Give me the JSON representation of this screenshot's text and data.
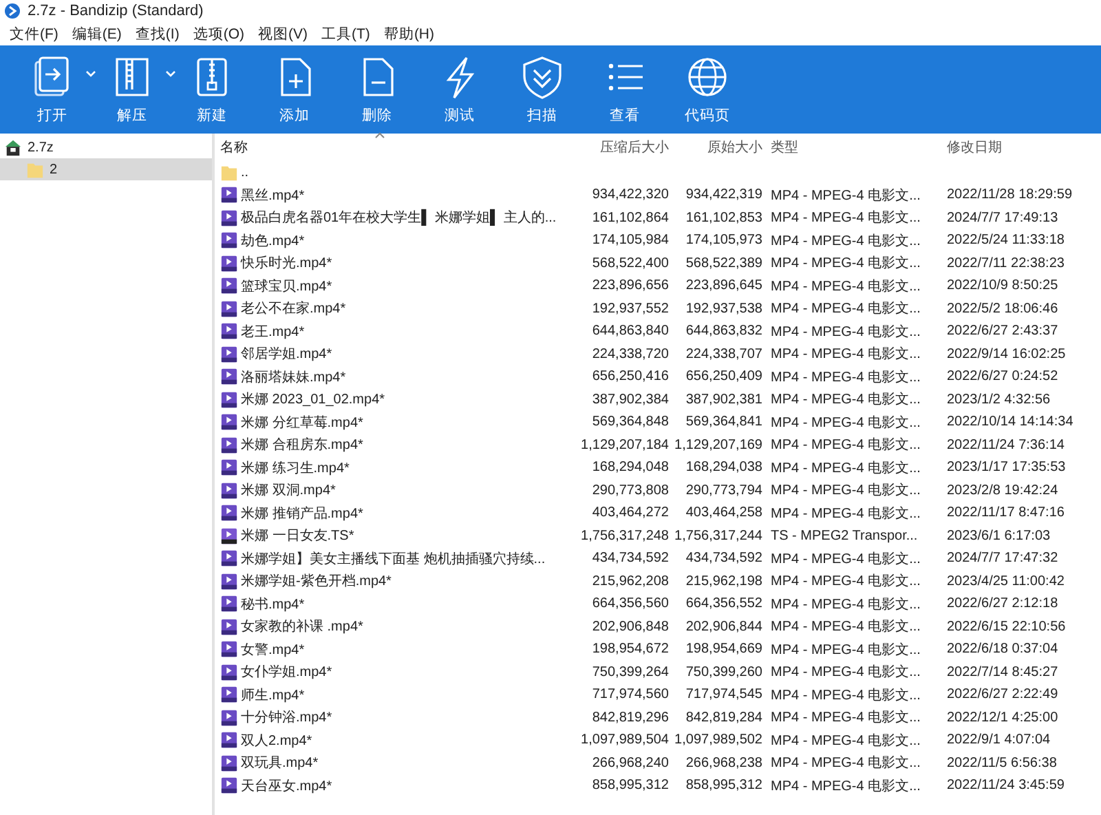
{
  "window": {
    "title": "2.7z - Bandizip (Standard)"
  },
  "menu": [
    "文件(F)",
    "编辑(E)",
    "查找(I)",
    "选项(O)",
    "视图(V)",
    "工具(T)",
    "帮助(H)"
  ],
  "toolbar": [
    {
      "label": "打开",
      "kind": "open",
      "has_menu": true
    },
    {
      "label": "解压",
      "kind": "extract",
      "has_menu": true
    },
    {
      "label": "新建",
      "kind": "new",
      "has_menu": false
    },
    {
      "label": "添加",
      "kind": "add",
      "has_menu": false
    },
    {
      "label": "删除",
      "kind": "delete",
      "has_menu": false
    },
    {
      "label": "测试",
      "kind": "test",
      "has_menu": false
    },
    {
      "label": "扫描",
      "kind": "scan",
      "has_menu": false
    },
    {
      "label": "查看",
      "kind": "view",
      "has_menu": false
    },
    {
      "label": "代码页",
      "kind": "codepage",
      "has_menu": false
    }
  ],
  "tree": [
    {
      "label": "2.7z",
      "kind": "archive",
      "selected": false,
      "children": [
        {
          "label": "2",
          "kind": "folder",
          "selected": true
        }
      ]
    }
  ],
  "table": {
    "columns": [
      {
        "label": "名称",
        "sorted": true
      },
      {
        "label": "压缩后大小",
        "sorted": false
      },
      {
        "label": "原始大小",
        "sorted": false
      },
      {
        "label": "类型",
        "sorted": false
      },
      {
        "label": "修改日期",
        "sorted": false
      }
    ],
    "rows": [
      {
        "kind": "folder",
        "name": ".."
      },
      {
        "kind": "mp4",
        "name": "黑丝.mp4*",
        "packed": "934,422,320",
        "size": "934,422,319",
        "type": "MP4 - MPEG-4 电影文...",
        "date": "2022/11/28 18:29:59"
      },
      {
        "kind": "mp4",
        "name": "极品白虎名器01年在校大学生▌ 米娜学姐▌ 主人的...",
        "packed": "161,102,864",
        "size": "161,102,853",
        "type": "MP4 - MPEG-4 电影文...",
        "date": "2024/7/7 17:49:13"
      },
      {
        "kind": "mp4",
        "name": "劫色.mp4*",
        "packed": "174,105,984",
        "size": "174,105,973",
        "type": "MP4 - MPEG-4 电影文...",
        "date": "2022/5/24 11:33:18"
      },
      {
        "kind": "mp4",
        "name": "快乐时光.mp4*",
        "packed": "568,522,400",
        "size": "568,522,389",
        "type": "MP4 - MPEG-4 电影文...",
        "date": "2022/7/11 22:38:23"
      },
      {
        "kind": "mp4",
        "name": "篮球宝贝.mp4*",
        "packed": "223,896,656",
        "size": "223,896,645",
        "type": "MP4 - MPEG-4 电影文...",
        "date": "2022/10/9 8:50:25"
      },
      {
        "kind": "mp4",
        "name": "老公不在家.mp4*",
        "packed": "192,937,552",
        "size": "192,937,538",
        "type": "MP4 - MPEG-4 电影文...",
        "date": "2022/5/2 18:06:46"
      },
      {
        "kind": "mp4",
        "name": "老王.mp4*",
        "packed": "644,863,840",
        "size": "644,863,832",
        "type": "MP4 - MPEG-4 电影文...",
        "date": "2022/6/27 2:43:37"
      },
      {
        "kind": "mp4",
        "name": "邻居学姐.mp4*",
        "packed": "224,338,720",
        "size": "224,338,707",
        "type": "MP4 - MPEG-4 电影文...",
        "date": "2022/9/14 16:02:25"
      },
      {
        "kind": "mp4",
        "name": "洛丽塔妹妹.mp4*",
        "packed": "656,250,416",
        "size": "656,250,409",
        "type": "MP4 - MPEG-4 电影文...",
        "date": "2022/6/27 0:24:52"
      },
      {
        "kind": "mp4",
        "name": "米娜 2023_01_02.mp4*",
        "packed": "387,902,384",
        "size": "387,902,381",
        "type": "MP4 - MPEG-4 电影文...",
        "date": "2023/1/2 4:32:56"
      },
      {
        "kind": "mp4",
        "name": "米娜 分红草莓.mp4*",
        "packed": "569,364,848",
        "size": "569,364,841",
        "type": "MP4 - MPEG-4 电影文...",
        "date": "2022/10/14 14:14:34"
      },
      {
        "kind": "mp4",
        "name": "米娜 合租房东.mp4*",
        "packed": "1,129,207,184",
        "size": "1,129,207,169",
        "type": "MP4 - MPEG-4 电影文...",
        "date": "2022/11/24 7:36:14"
      },
      {
        "kind": "mp4",
        "name": "米娜 练习生.mp4*",
        "packed": "168,294,048",
        "size": "168,294,038",
        "type": "MP4 - MPEG-4 电影文...",
        "date": "2023/1/17 17:35:53"
      },
      {
        "kind": "mp4",
        "name": "米娜 双洞.mp4*",
        "packed": "290,773,808",
        "size": "290,773,794",
        "type": "MP4 - MPEG-4 电影文...",
        "date": "2023/2/8 19:42:24"
      },
      {
        "kind": "mp4",
        "name": "米娜 推销产品.mp4*",
        "packed": "403,464,272",
        "size": "403,464,258",
        "type": "MP4 - MPEG-4 电影文...",
        "date": "2022/11/17 8:47:16"
      },
      {
        "kind": "ts",
        "name": "米娜 一日女友.TS*",
        "packed": "1,756,317,248",
        "size": "1,756,317,244",
        "type": "TS - MPEG2 Transpor...",
        "date": "2023/6/1 6:17:03"
      },
      {
        "kind": "mp4",
        "name": "米娜学姐】美女主播线下面基 炮机抽插骚穴持续...",
        "packed": "434,734,592",
        "size": "434,734,592",
        "type": "MP4 - MPEG-4 电影文...",
        "date": "2024/7/7 17:47:32"
      },
      {
        "kind": "mp4",
        "name": "米娜学姐-紫色开档.mp4*",
        "packed": "215,962,208",
        "size": "215,962,198",
        "type": "MP4 - MPEG-4 电影文...",
        "date": "2023/4/25 11:00:42"
      },
      {
        "kind": "mp4",
        "name": "秘书.mp4*",
        "packed": "664,356,560",
        "size": "664,356,552",
        "type": "MP4 - MPEG-4 电影文...",
        "date": "2022/6/27 2:12:18"
      },
      {
        "kind": "mp4",
        "name": "女家教的补课 .mp4*",
        "packed": "202,906,848",
        "size": "202,906,844",
        "type": "MP4 - MPEG-4 电影文...",
        "date": "2022/6/15 22:10:56"
      },
      {
        "kind": "mp4",
        "name": "女警.mp4*",
        "packed": "198,954,672",
        "size": "198,954,669",
        "type": "MP4 - MPEG-4 电影文...",
        "date": "2022/6/18 0:37:04"
      },
      {
        "kind": "mp4",
        "name": "女仆学姐.mp4*",
        "packed": "750,399,264",
        "size": "750,399,260",
        "type": "MP4 - MPEG-4 电影文...",
        "date": "2022/7/14 8:45:27"
      },
      {
        "kind": "mp4",
        "name": "师生.mp4*",
        "packed": "717,974,560",
        "size": "717,974,545",
        "type": "MP4 - MPEG-4 电影文...",
        "date": "2022/6/27 2:22:49"
      },
      {
        "kind": "mp4",
        "name": "十分钟浴.mp4*",
        "packed": "842,819,296",
        "size": "842,819,284",
        "type": "MP4 - MPEG-4 电影文...",
        "date": "2022/12/1 4:25:00"
      },
      {
        "kind": "mp4",
        "name": "双人2.mp4*",
        "packed": "1,097,989,504",
        "size": "1,097,989,502",
        "type": "MP4 - MPEG-4 电影文...",
        "date": "2022/9/1 4:07:04"
      },
      {
        "kind": "mp4",
        "name": "双玩具.mp4*",
        "packed": "266,968,240",
        "size": "266,968,238",
        "type": "MP4 - MPEG-4 电影文...",
        "date": "2022/11/5 6:56:38"
      },
      {
        "kind": "mp4",
        "name": "天台巫女.mp4*",
        "packed": "858,995,312",
        "size": "858,995,312",
        "type": "MP4 - MPEG-4 电影文...",
        "date": "2022/11/24 3:45:59"
      }
    ]
  }
}
